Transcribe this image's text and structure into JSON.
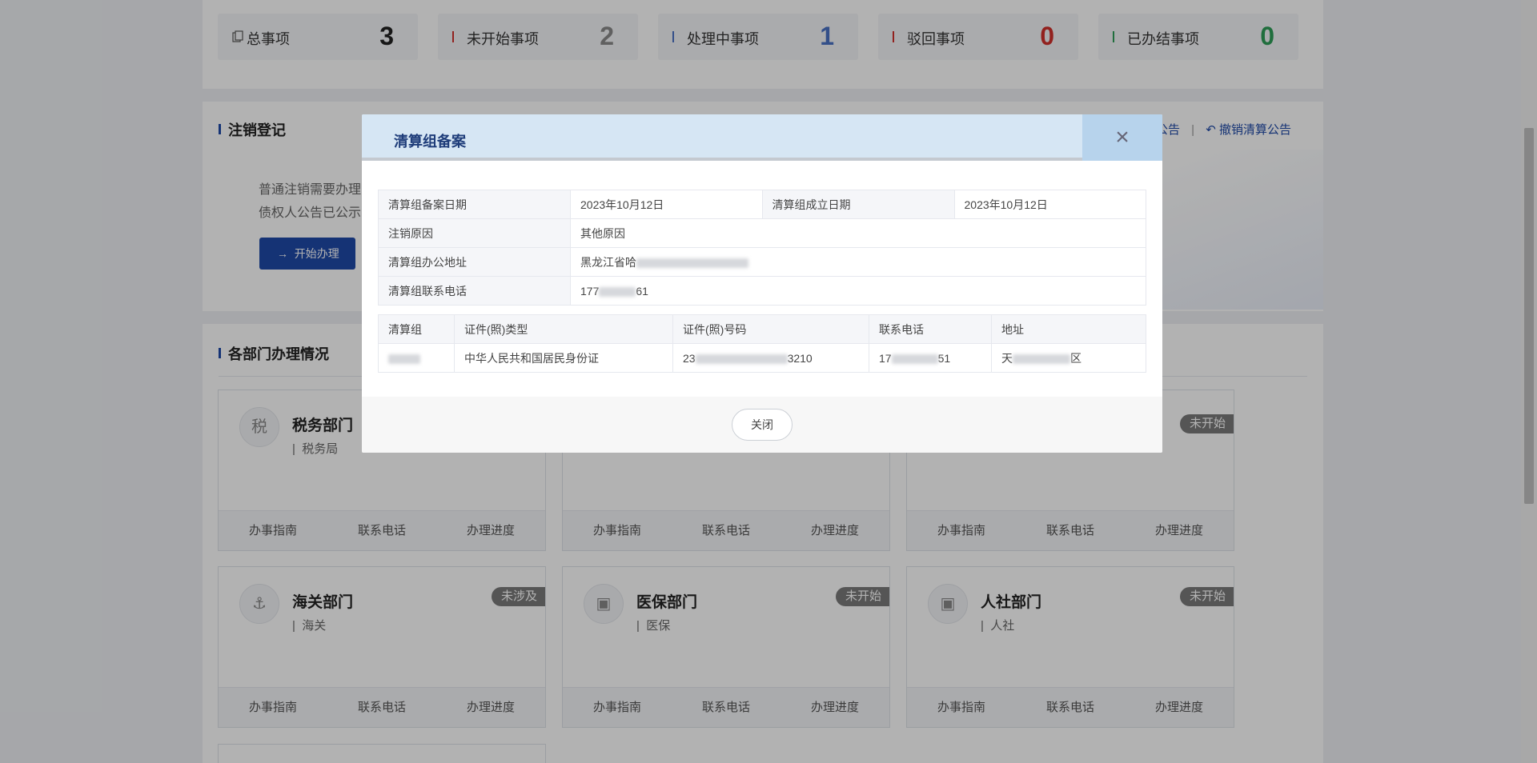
{
  "stats": [
    {
      "label": "总事项",
      "value": "3",
      "color": "#222222"
    },
    {
      "label": "未开始事项",
      "value": "2",
      "color": "#8a8a8a"
    },
    {
      "label": "处理中事项",
      "value": "1",
      "color": "#4a72c4"
    },
    {
      "label": "驳回事项",
      "value": "0",
      "color": "#d2302c"
    },
    {
      "label": "已办结事项",
      "value": "0",
      "color": "#2e9e58"
    }
  ],
  "deregistration": {
    "title": "注销登记",
    "line1": "普通注销需要办理",
    "line2": "债权人公告已公示",
    "start_button": "开始办理",
    "link_announce": "公告",
    "link_revoke": "撤销清算公告"
  },
  "departments": {
    "title": "各部门办理情况",
    "footer_labels": [
      "办事指南",
      "联系电话",
      "办理进度"
    ],
    "cards": [
      {
        "name": "税务部门",
        "sub": "税务局",
        "badge": ""
      },
      {
        "name": "",
        "sub": "",
        "badge": ""
      },
      {
        "name": "",
        "sub": "",
        "badge": "未开始"
      },
      {
        "name": "海关部门",
        "sub": "海关",
        "badge": "未涉及"
      },
      {
        "name": "医保部门",
        "sub": "医保",
        "badge": "未开始"
      },
      {
        "name": "人社部门",
        "sub": "人社",
        "badge": "未开始"
      }
    ]
  },
  "modal": {
    "title": "清算组备案",
    "close_icon": "×",
    "info": {
      "filing_date_label": "清算组备案日期",
      "filing_date": "2023年10月12日",
      "established_date_label": "清算组成立日期",
      "established_date": "2023年10月12日",
      "reason_label": "注销原因",
      "reason": "其他原因",
      "address_label": "清算组办公地址",
      "address": "黑龙江省哈",
      "phone_label": "清算组联系电话",
      "phone_prefix": "177",
      "phone_suffix": "61"
    },
    "members": {
      "headers": [
        "清算组",
        "证件(照)类型",
        "证件(照)号码",
        "联系电话",
        "地址"
      ],
      "rows": [
        {
          "id_type": "中华人民共和国居民身份证",
          "id_prefix": "23",
          "id_suffix": "3210",
          "phone_prefix": "17",
          "phone_suffix": "51",
          "addr_prefix": "天",
          "addr_suffix": "区"
        }
      ]
    },
    "close_button": "关闭"
  }
}
